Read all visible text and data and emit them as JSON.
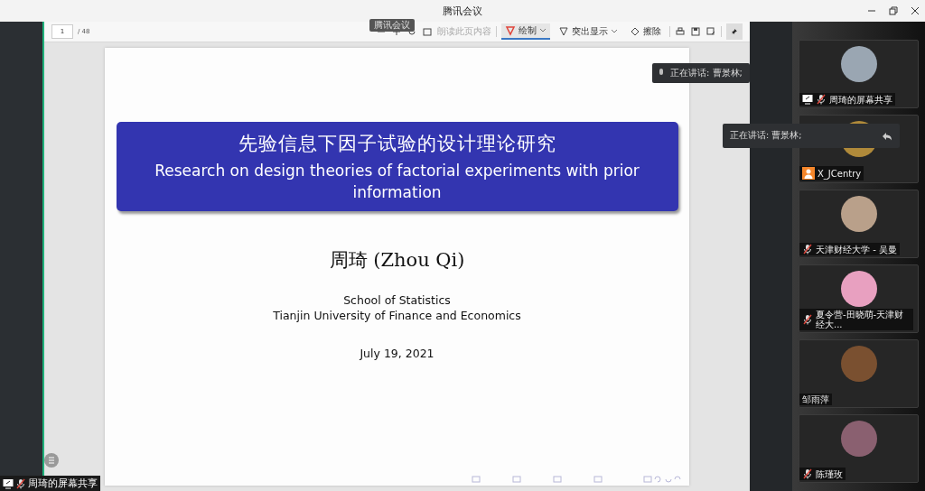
{
  "window": {
    "title": "腾讯会议"
  },
  "pdf_toolbar": {
    "page_number": "1",
    "page_total": "/ 48",
    "overlay_tag": "腾讯会议",
    "read_aloud": "朗读此页内容",
    "tools": [
      {
        "kind": "draw",
        "label": "绘制",
        "selected": true,
        "dropdown": true
      },
      {
        "kind": "highlight",
        "label": "突出显示",
        "selected": false,
        "dropdown": true
      },
      {
        "kind": "erase",
        "label": "擦除",
        "selected": false,
        "dropdown": false
      }
    ],
    "pinned": true
  },
  "slide": {
    "title_zh": "先验信息下因子试验的设计理论研究",
    "title_en": "Research on design theories of factorial experiments with prior information",
    "author": "周琦 (Zhou Qi)",
    "affiliation": [
      "School of Statistics",
      "Tianjin University of Finance and Economics"
    ],
    "date": "July 19, 2021"
  },
  "speaking_badge": {
    "text": "正在讲话: 曹景林;"
  },
  "speaking_popup": {
    "text": "正在讲话: 曹景林;"
  },
  "participants": [
    {
      "name": "周琦的屏幕共享",
      "kind": "sharing"
    },
    {
      "name": "X_JCentry",
      "kind": "user"
    },
    {
      "name": "天津财经大学 - 吴曼",
      "kind": "muted"
    },
    {
      "name": "夏令营-田晓萌-天津财经大...",
      "kind": "muted"
    },
    {
      "name": "邹雨萍",
      "kind": "plain"
    },
    {
      "name": "陈瑾玫",
      "kind": "muted"
    }
  ],
  "screen_share_label": "周琦的屏幕共享"
}
